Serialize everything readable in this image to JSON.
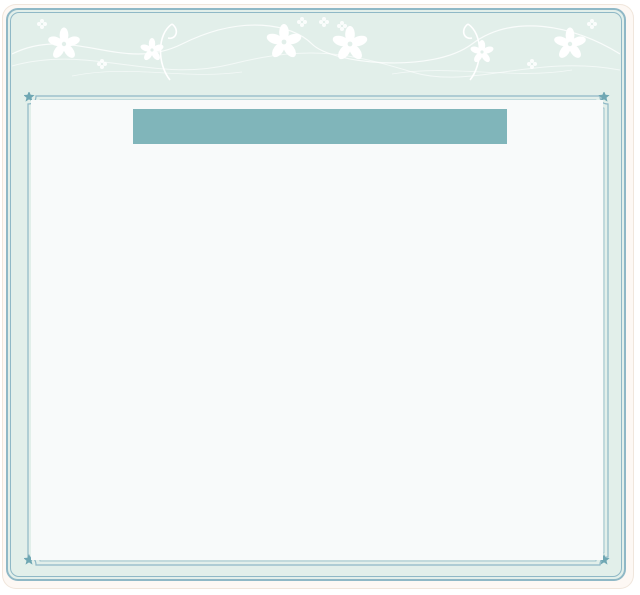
{
  "colors": {
    "frame_border": "#8fb8c6",
    "frame_fill": "#e2efea",
    "panel_fill": "#f8fafa",
    "title_bar": "#80b5ba",
    "ornament": "#ffffff"
  },
  "icons": {
    "header": "floral-ornament",
    "corners": "star-ornament"
  },
  "title_bar": {
    "text": ""
  }
}
